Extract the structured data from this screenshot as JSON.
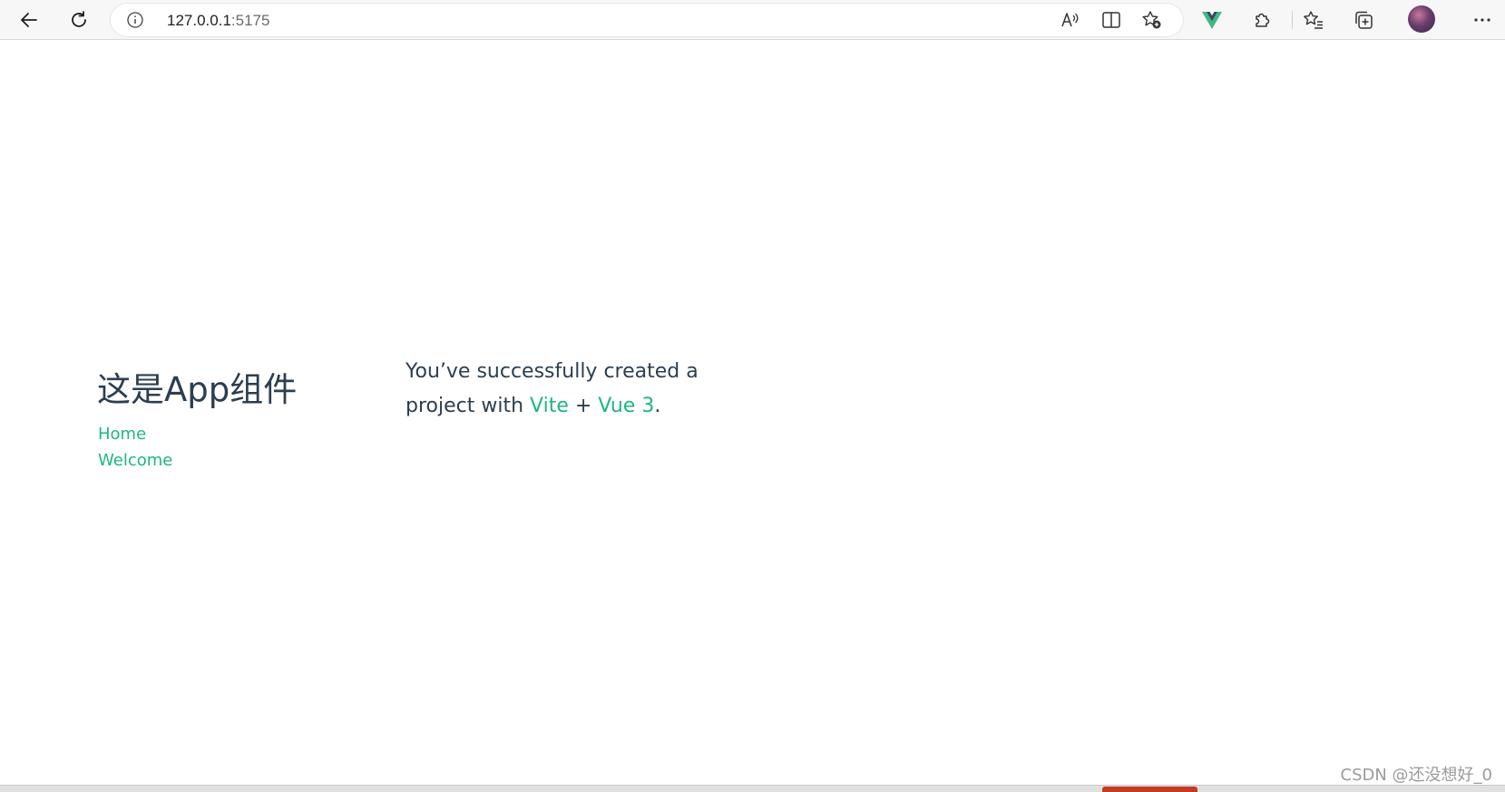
{
  "browser": {
    "url_host": "127.0.0.1",
    "url_port": ":5175",
    "icons": [
      "back-icon",
      "refresh-icon",
      "site-info-icon",
      "read-aloud-icon",
      "split-screen-icon",
      "add-favorite-icon",
      "vue-devtools-icon",
      "extensions-icon",
      "favorites-icon",
      "collections-icon",
      "profile-avatar",
      "more-icon"
    ]
  },
  "page": {
    "title": "这是App组件",
    "nav": [
      {
        "label": "Home"
      },
      {
        "label": "Welcome"
      }
    ],
    "greeting": {
      "prefix": "You’ve successfully created a project with ",
      "vite_link": "Vite",
      "separator": " + ",
      "vue_link": "Vue 3",
      "suffix": "."
    }
  },
  "watermark": "CSDN @还没想好_0",
  "colors": {
    "accent": "#1eb77f",
    "text": "#2c3e50",
    "vue_green": "#41b883"
  }
}
